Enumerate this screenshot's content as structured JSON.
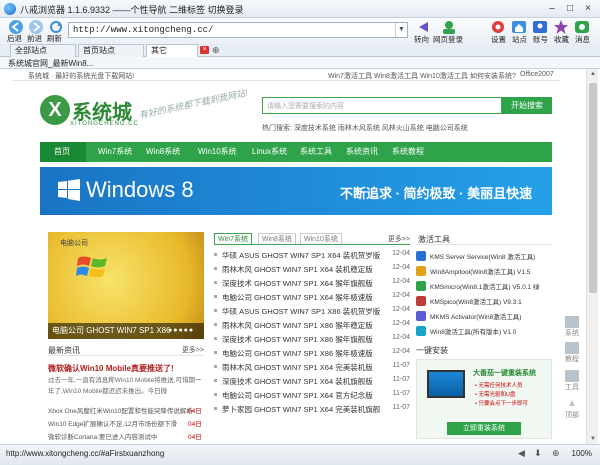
{
  "window": {
    "title": "八戒浏览器 1.1.6.9332 ——个性导航 二维标签 切换登录",
    "min": "–",
    "max": "□",
    "close": "×"
  },
  "toolbar": {
    "back": "后退",
    "forward": "前进",
    "refresh": "刷新",
    "url": "http://www.xitongcheng.cc/",
    "redirect": "转向",
    "site_login": "网页登录",
    "settings": "设置",
    "sites": "站点",
    "account": "账号",
    "favorites": "收藏",
    "messages": "消息"
  },
  "tabs": [
    "全部站点",
    "首页站点",
    "其它"
  ],
  "favbar": {
    "label": "系统城官网_最新Win8..."
  },
  "page": {
    "topnav_left": "系统城 · 最好的系统光盘下载网站!",
    "topnav_links": [
      "Win7激活工具",
      "Win8激活工具",
      "Win10激活工具",
      "如何安装系统?",
      "Office2007"
    ],
    "logo_name": "系统城",
    "logo_sub": "XITONGCHENG.CC",
    "slogan": "有好的系统都下载到我网站!",
    "search_placeholder": "请输入您需要搜索的内容",
    "search_button": "开始搜索",
    "hot": "热门搜索:  深度技术系统   雨林木风系统   风林火山系统   电脑公司系统",
    "nav": [
      "首页",
      "Win7系统",
      "Win8系统",
      "Win10系统",
      "Linux系统",
      "系统工具",
      "系统资讯",
      "系统教程"
    ],
    "banner_title": "Windows 8",
    "banner_tag": "不断追求 · 简约极致 · 美丽且快速",
    "feature_top": "电脑公司",
    "feature_caption": "电脑公司  GHOST WIN7 SP1 X86",
    "latest_title": "最新资讯",
    "latest_more": "更多>>",
    "lead_title": "微软确认Win10 Mobile真要推送了!",
    "lead_desc": "过去一年,一直有消息称Win10 Mobile将推送,可惜期一年了,Win10 Mobile都迟迟未推出。今日微",
    "news": [
      {
        "title": "Xbox One风靡红米Win10配置和性能突降传说解析",
        "date": "04日"
      },
      {
        "title": "Win10 Edge扩展确认不足,12月市场份额下滑",
        "date": "04日"
      },
      {
        "title": "微软诊断Cortana:要已进入内容测试中",
        "date": "04日"
      }
    ],
    "sys_tabs": [
      "Win7系统",
      "Win8系统",
      "Win10系统"
    ],
    "sys_more": "更多>>",
    "downloads": [
      {
        "name": "华硕 ASUS GHOST WIN7 SP1 X64 装机贺岁版",
        "date": "12-04"
      },
      {
        "name": "雨林木风 GHOST WIN7 SP1 X64 装机稳定版",
        "date": "12-04"
      },
      {
        "name": "深度技术 GHOST WIN7 SP1 X64 猴年旗舰版",
        "date": "12-04"
      },
      {
        "name": "电脑公司 GHOST WIN7 SP1 X64 猴年极速版",
        "date": "12-04"
      },
      {
        "name": "华硕 ASUS GHOST WIN7 SP1 X86 装机贺岁版",
        "date": "12-04"
      },
      {
        "name": "雨林木风 GHOST WIN7 SP1 X86 猴年稳定版",
        "date": "12-04"
      },
      {
        "name": "深度技术 GHOST WIN7 SP1 X86 猴年旗舰版",
        "date": "12-04"
      },
      {
        "name": "电脑公司 GHOST WIN7 SP1 X86 猴年极速版",
        "date": "12-04"
      },
      {
        "name": "雨林木风 GHOST WIN7 SP1 X64 完美装机版",
        "date": "11-07"
      },
      {
        "name": "深度技术 GHOST WIN7 SP1 X64 装机旗舰版",
        "date": "11-07"
      },
      {
        "name": "电脑公司 GHOST WIN7 SP1 X64 官方纪念版",
        "date": "11-07"
      },
      {
        "name": "萝卜家园 GHOST WIN7 SP1 X64 完美装机旗舰",
        "date": "11-07"
      }
    ],
    "tools_title": "激活工具",
    "tools": [
      "KMS Server Service(Win8 激活工具)",
      "Win8Ampitool(Win8激活工具) V1.5",
      "KMSmicro(Win8.1激活工具) V5.0.1 绿",
      "KMSpico(Win8激活工具) V9.3.1",
      "MKMS Activator(Win8激活工具)",
      "Win8激活工具(所有版本) V1.0"
    ],
    "install_title": "一键安装",
    "install_ad_title": "大番茄一键重装系统",
    "install_features": [
      "• 无需任何技术人员",
      "• 无需光驱和U盘",
      "• 只要会点下一步即可"
    ],
    "install_button": "立即重装系统",
    "side_float": [
      "系统",
      "教程",
      "工具",
      "顶部"
    ]
  },
  "status": {
    "url": "http://www.xitongcheng.cc/#aFirstxuanzhong",
    "zoom": "100%"
  },
  "colors": {
    "brand_green": "#2ea34a",
    "banner_blue": "#1a74c4",
    "accent_red": "#b02020"
  }
}
